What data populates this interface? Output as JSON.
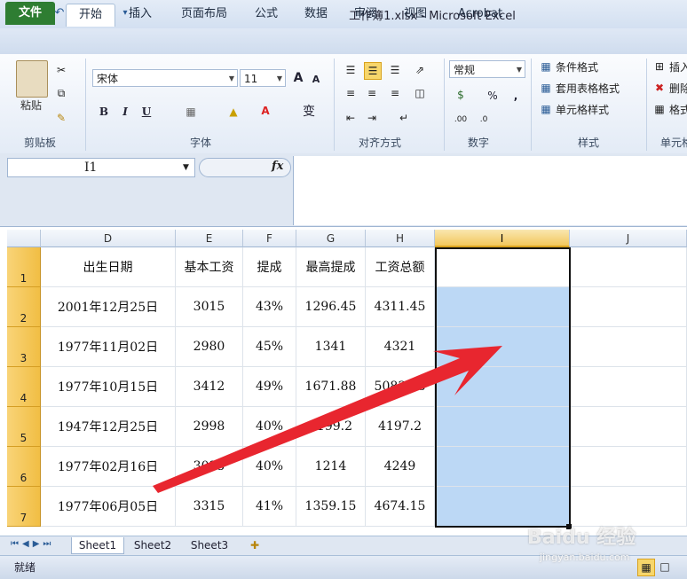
{
  "window": {
    "title": "工作簿1.xlsx - Microsoft Excel",
    "app_icon": "X"
  },
  "quick_access": {
    "save_icon": "save-icon",
    "undo_icon": "undo-icon",
    "redo_icon": "redo-icon"
  },
  "tabs": [
    "文件",
    "开始",
    "插入",
    "页面布局",
    "公式",
    "数据",
    "审阅",
    "视图",
    "Acrobat"
  ],
  "ribbon": {
    "clipboard": {
      "paste": "粘贴",
      "label": "剪贴板"
    },
    "font": {
      "name": "宋体",
      "size": "11",
      "label": "字体",
      "bold": "B",
      "italic": "I",
      "underline": "U",
      "grow": "A",
      "shrink": "A",
      "phonetic": "变"
    },
    "alignment": {
      "label": "对齐方式"
    },
    "number": {
      "format": "常规",
      "label": "数字",
      "percent": "%",
      "comma": ","
    },
    "styles": {
      "cond_format": "条件格式",
      "table_format": "套用表格格式",
      "cell_styles": "单元格样式",
      "label": "样式"
    },
    "cells": {
      "insert": "插入",
      "delete": "删除",
      "format": "格式",
      "label": "单元格"
    }
  },
  "formula_bar": {
    "name_box": "I1",
    "fx": "fx",
    "content": ""
  },
  "columns": [
    "D",
    "E",
    "F",
    "G",
    "H",
    "I",
    "J"
  ],
  "selected_column": "I",
  "rows": [
    {
      "num": "1",
      "cells": [
        "出生日期",
        "基本工资",
        "提成",
        "最高提成",
        "工资总额",
        "",
        ""
      ]
    },
    {
      "num": "2",
      "cells": [
        "2001年12月25日",
        "3015",
        "43%",
        "1296.45",
        "4311.45",
        "",
        ""
      ]
    },
    {
      "num": "3",
      "cells": [
        "1977年11月02日",
        "2980",
        "45%",
        "1341",
        "4321",
        "",
        ""
      ]
    },
    {
      "num": "4",
      "cells": [
        "1977年10月15日",
        "3412",
        "49%",
        "1671.88",
        "5083.88",
        "",
        ""
      ]
    },
    {
      "num": "5",
      "cells": [
        "1947年12月25日",
        "2998",
        "40%",
        "1199.2",
        "4197.2",
        "",
        ""
      ]
    },
    {
      "num": "6",
      "cells": [
        "1977年02月16日",
        "3035",
        "40%",
        "1214",
        "4249",
        "",
        ""
      ]
    },
    {
      "num": "7",
      "cells": [
        "1977年06月05日",
        "3315",
        "41%",
        "1359.15",
        "4674.15",
        "",
        ""
      ]
    }
  ],
  "sheets": [
    "Sheet1",
    "Sheet2",
    "Sheet3"
  ],
  "status": {
    "ready": "就绪"
  },
  "watermark": {
    "brand": "Baidu 经验",
    "url": "jingyan.baidu.com"
  },
  "colors": {
    "file_tab": "#2e7d32",
    "selection": "#bcd8f5",
    "row_header": "#f1be44",
    "arrow": "#e8262f"
  }
}
